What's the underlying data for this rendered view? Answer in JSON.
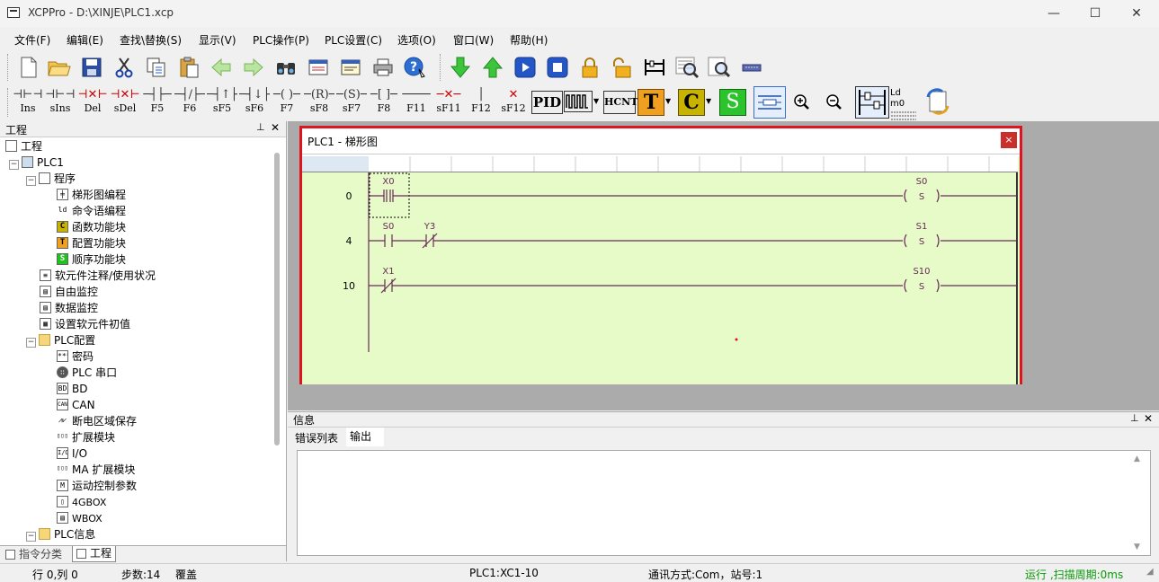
{
  "window": {
    "title": "XCPPro - D:\\XINJE\\PLC1.xcp",
    "minimize": "—",
    "maximize": "☐",
    "close": "✕"
  },
  "menu": [
    "文件(F)",
    "编辑(E)",
    "查找\\替换(S)",
    "显示(V)",
    "PLC操作(P)",
    "PLC设置(C)",
    "选项(O)",
    "窗口(W)",
    "帮助(H)"
  ],
  "ladder_toolbar": [
    {
      "label": "Ins",
      "sym": "⊣⊢⊣⊢"
    },
    {
      "label": "sIns",
      "sym": "⊣⊢⊣⊢"
    },
    {
      "label": "Del",
      "sym": "⊣✕⊢"
    },
    {
      "label": "sDel",
      "sym": "⊣✕⊢"
    },
    {
      "label": "F5",
      "sym": "─┤├─"
    },
    {
      "label": "F6",
      "sym": "─┤/├─"
    },
    {
      "label": "sF5",
      "sym": "─┤↑├─"
    },
    {
      "label": "sF6",
      "sym": "─┤↓├─"
    },
    {
      "label": "F7",
      "sym": "─(  )─"
    },
    {
      "label": "sF8",
      "sym": "─(R)─"
    },
    {
      "label": "sF7",
      "sym": "─(S)─"
    },
    {
      "label": "F8",
      "sym": "─[  ]─"
    },
    {
      "label": "F11",
      "sym": "────"
    },
    {
      "label": "sF11",
      "sym": "─✕─"
    },
    {
      "label": "F12",
      "sym": "│"
    },
    {
      "label": "sF12",
      "sym": "✕"
    }
  ],
  "toolbar2_extra": {
    "pid": "PID",
    "hcnt": "HCNT",
    "t": "T",
    "c": "C",
    "s": "S",
    "ldm0": "Ld m0"
  },
  "project_panel": {
    "title": "工程",
    "pin": "📌",
    "close": "✕",
    "tree": [
      {
        "label": "工程",
        "icon": "project-icon",
        "level": 0
      },
      {
        "label": "PLC1",
        "icon": "plc-icon",
        "level": 1
      },
      {
        "label": "程序",
        "icon": "program-icon",
        "level": 2
      },
      {
        "label": "梯形图编程",
        "icon": "ladder-icon",
        "level": 3
      },
      {
        "label": "命令语编程",
        "icon": "instruction-icon",
        "level": 3
      },
      {
        "label": "函数功能块",
        "icon": "function-block-icon",
        "level": 3
      },
      {
        "label": "配置功能块",
        "icon": "config-block-icon",
        "level": 3
      },
      {
        "label": "顺序功能块",
        "icon": "sequence-block-icon",
        "level": 3
      },
      {
        "label": "软元件注释/使用状况",
        "icon": "device-comment-icon",
        "level": 2
      },
      {
        "label": "自由监控",
        "icon": "free-monitor-icon",
        "level": 2
      },
      {
        "label": "数据监控",
        "icon": "data-monitor-icon",
        "level": 2
      },
      {
        "label": "设置软元件初值",
        "icon": "device-init-icon",
        "level": 2
      },
      {
        "label": "PLC配置",
        "icon": "folder-icon",
        "level": 2
      },
      {
        "label": "密码",
        "icon": "password-icon",
        "level": 3
      },
      {
        "label": "PLC 串口",
        "icon": "serial-port-icon",
        "level": 3
      },
      {
        "label": "BD",
        "icon": "bd-icon",
        "level": 3
      },
      {
        "label": "CAN",
        "icon": "can-icon",
        "level": 3
      },
      {
        "label": "断电区域保存",
        "icon": "power-save-icon",
        "level": 3
      },
      {
        "label": "扩展模块",
        "icon": "expansion-module-icon",
        "level": 3
      },
      {
        "label": "I/O",
        "icon": "io-icon",
        "level": 3
      },
      {
        "label": "MA 扩展模块",
        "icon": "ma-module-icon",
        "level": 3
      },
      {
        "label": "运动控制参数",
        "icon": "motion-control-icon",
        "level": 3
      },
      {
        "label": "4GBOX",
        "icon": "4gbox-icon",
        "level": 3
      },
      {
        "label": "WBOX",
        "icon": "wbox-icon",
        "level": 3
      },
      {
        "label": "PLC信息",
        "icon": "folder-icon",
        "level": 2
      }
    ],
    "tabs": [
      "指令分类",
      "工程"
    ]
  },
  "ladder_window": {
    "title": "PLC1 - 梯形图",
    "close": "×",
    "rungs": [
      {
        "step": "0",
        "contacts": [
          {
            "name": "X0",
            "type": "rising-edge"
          }
        ],
        "coil": {
          "name": "S0",
          "type": "S"
        }
      },
      {
        "step": "4",
        "contacts": [
          {
            "name": "S0",
            "type": "NO"
          },
          {
            "name": "Y3",
            "type": "rising-edge-NC"
          }
        ],
        "coil": {
          "name": "S1",
          "type": "S"
        }
      },
      {
        "step": "10",
        "contacts": [
          {
            "name": "X1",
            "type": "NC-edge"
          }
        ],
        "coil": {
          "name": "S10",
          "type": "S"
        }
      }
    ]
  },
  "info_panel": {
    "title": "信息",
    "pin": "📌",
    "close": "✕",
    "tabs": [
      "错误列表",
      "输出"
    ]
  },
  "status": {
    "position": "行 0,列 0",
    "steps": "步数:14",
    "mode": "覆盖",
    "plc": "PLC1:XC1-10",
    "comm": "通讯方式:Com，站号:1",
    "run": "运行 ,扫描周期:0ms"
  },
  "colors": {
    "accent_red": "#e0141e",
    "ladder_bg": "#e6fbc8",
    "run_status": "#0a9a0a"
  }
}
